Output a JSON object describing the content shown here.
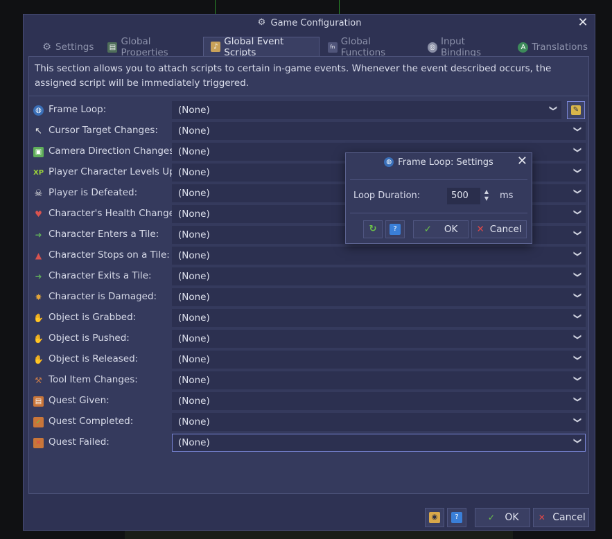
{
  "window": {
    "title": "Game Configuration",
    "title_icon": "gear-icon",
    "close_glyph": "✕"
  },
  "tabs": [
    {
      "label": "Settings",
      "icon": "gear-icon",
      "active": false
    },
    {
      "label": "Global Properties",
      "icon": "properties-icon",
      "active": false
    },
    {
      "label": "Global Event Scripts",
      "icon": "script-icon",
      "active": true
    },
    {
      "label": "Global Functions",
      "icon": "function-icon",
      "active": false
    },
    {
      "label": "Input Bindings",
      "icon": "input-icon",
      "active": false
    },
    {
      "label": "Translations",
      "icon": "translations-icon",
      "active": false
    }
  ],
  "description": "This section allows you to attach scripts to certain in-game events. Whenever the event described occurs, the assigned script will be immediately triggered.",
  "events": [
    {
      "label": "Frame Loop:",
      "value": "(None)",
      "icon": "globe-icon",
      "color": "#3a6fb8"
    },
    {
      "label": "Cursor Target Changes:",
      "value": "(None)",
      "icon": "cursor-icon",
      "color": "#e8e8e8"
    },
    {
      "label": "Camera Direction Changes:",
      "value": "(None)",
      "icon": "camera-icon",
      "color": "#5fae5a"
    },
    {
      "label": "Player Character Levels Up:",
      "value": "(None)",
      "icon": "xp-icon",
      "color": "#9ad13b"
    },
    {
      "label": "Player is Defeated:",
      "value": "(None)",
      "icon": "skull-icon",
      "color": "#e6e6e6"
    },
    {
      "label": "Character's Health Changes:",
      "value": "(None)",
      "icon": "health-icon",
      "color": "#d9534f"
    },
    {
      "label": "Character Enters a Tile:",
      "value": "(None)",
      "icon": "tile-enter-icon",
      "color": "#5fae5a"
    },
    {
      "label": "Character Stops on a Tile:",
      "value": "(None)",
      "icon": "tile-stop-icon",
      "color": "#d9534f"
    },
    {
      "label": "Character Exits a Tile:",
      "value": "(None)",
      "icon": "tile-exit-icon",
      "color": "#5fae5a"
    },
    {
      "label": "Character is Damaged:",
      "value": "(None)",
      "icon": "damage-icon",
      "color": "#e0a33a"
    },
    {
      "label": "Object is Grabbed:",
      "value": "(None)",
      "icon": "grab-icon",
      "color": "#e8c9a6"
    },
    {
      "label": "Object is Pushed:",
      "value": "(None)",
      "icon": "push-icon",
      "color": "#e8c9a6"
    },
    {
      "label": "Object is Released:",
      "value": "(None)",
      "icon": "release-icon",
      "color": "#e8c9a6"
    },
    {
      "label": "Tool Item Changes:",
      "value": "(None)",
      "icon": "tool-icon",
      "color": "#c97b4a"
    },
    {
      "label": "Quest Given:",
      "value": "(None)",
      "icon": "quest-given-icon",
      "color": "#c9763a"
    },
    {
      "label": "Quest Completed:",
      "value": "(None)",
      "icon": "quest-completed-icon",
      "color": "#c9763a"
    },
    {
      "label": "Quest Failed:",
      "value": "(None)",
      "icon": "quest-failed-icon",
      "color": "#c9763a"
    }
  ],
  "footer": {
    "ok_label": "OK",
    "cancel_label": "Cancel"
  },
  "popup": {
    "title": "Frame Loop: Settings",
    "field_label": "Loop Duration:",
    "field_value": "500",
    "unit": "ms",
    "ok_label": "OK",
    "cancel_label": "Cancel"
  },
  "colors": {
    "window_bg": "#2e3253",
    "panel_bg": "#353a5d",
    "combo_bg": "#2c3050",
    "focus": "#7a86d8",
    "ok_green": "#6cc24a",
    "cancel_red": "#e04848"
  }
}
